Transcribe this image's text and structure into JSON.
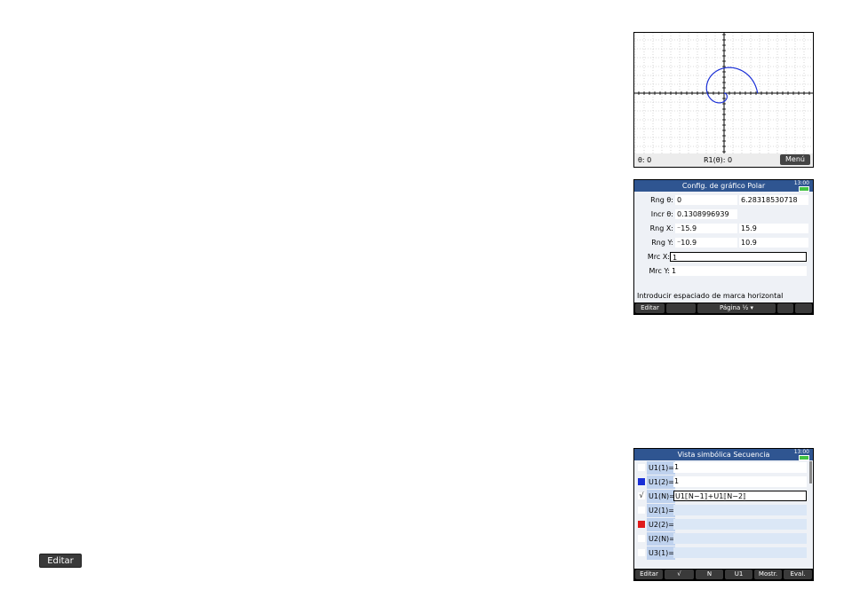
{
  "plot": {
    "theta_readout": "θ: 0",
    "r_readout": "R1(θ): 0",
    "menu_label": "Menú"
  },
  "polar_setup": {
    "title": "Config. de gráfico Polar",
    "time": "13:00",
    "rows": [
      {
        "label": "Rng θ:",
        "min": "0",
        "max": "6.28318530718"
      },
      {
        "label": "Incr θ:",
        "min": "0.1308996939",
        "max": ""
      },
      {
        "label": "Rng X:",
        "min": "⁻15.9",
        "max": "15.9"
      },
      {
        "label": "Rng Y:",
        "min": "⁻10.9",
        "max": "10.9"
      },
      {
        "label": "Mrc X:",
        "min": "1",
        "max": ""
      },
      {
        "label": "Mrc Y:",
        "min": "1",
        "max": ""
      }
    ],
    "hint": "Introducir espaciado de marca horizontal",
    "softkeys": [
      "Editar",
      "",
      "Página ½ ▾",
      "",
      ""
    ]
  },
  "sequence": {
    "title": "Vista simbólica Secuencia",
    "time": "13:00",
    "rows": [
      {
        "label": "U1(1)=",
        "value": "1",
        "check": "",
        "color": "#ffffff"
      },
      {
        "label": "U1(2)=",
        "value": "1",
        "check": "",
        "color": "#1a2fd6"
      },
      {
        "label": "U1(N)=",
        "value": "U1⟦N−1⟧+U1⟦N−2⟧",
        "check": "√",
        "color": "#ffffff"
      },
      {
        "label": "U2(1)=",
        "value": "",
        "check": "",
        "color": "#ffffff"
      },
      {
        "label": "U2(2)=",
        "value": "",
        "check": "",
        "color": "#e01b1b"
      },
      {
        "label": "U2(N)=",
        "value": "",
        "check": "",
        "color": "#ffffff"
      },
      {
        "label": "U3(1)=",
        "value": "",
        "check": "",
        "color": "#ffffff"
      }
    ],
    "softkeys": [
      "Editar",
      "√",
      "N",
      "U1",
      "Mostr.",
      "Eval."
    ]
  },
  "edit_button": {
    "label": "Editar"
  },
  "colors": {
    "title_bar": "#2f5591",
    "curve": "#1a2fd6"
  }
}
